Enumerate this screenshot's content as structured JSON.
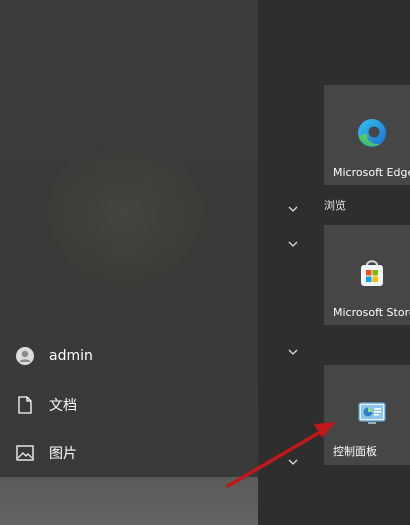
{
  "left_nav": {
    "user": {
      "name": "admin",
      "icon": "user-avatar-icon"
    },
    "documents": {
      "label": "文档",
      "icon": "document-icon"
    },
    "pictures": {
      "label": "图片",
      "icon": "picture-icon"
    }
  },
  "tiles": {
    "group_label": "浏览",
    "edge": {
      "label": "Microsoft Edge",
      "icon": "edge-browser-icon"
    },
    "store": {
      "label": "Microsoft Store",
      "icon": "store-bag-icon"
    },
    "control_panel": {
      "label": "控制面板",
      "icon": "control-panel-icon"
    }
  },
  "annotation": {
    "arrow_color": "#c0181a"
  }
}
